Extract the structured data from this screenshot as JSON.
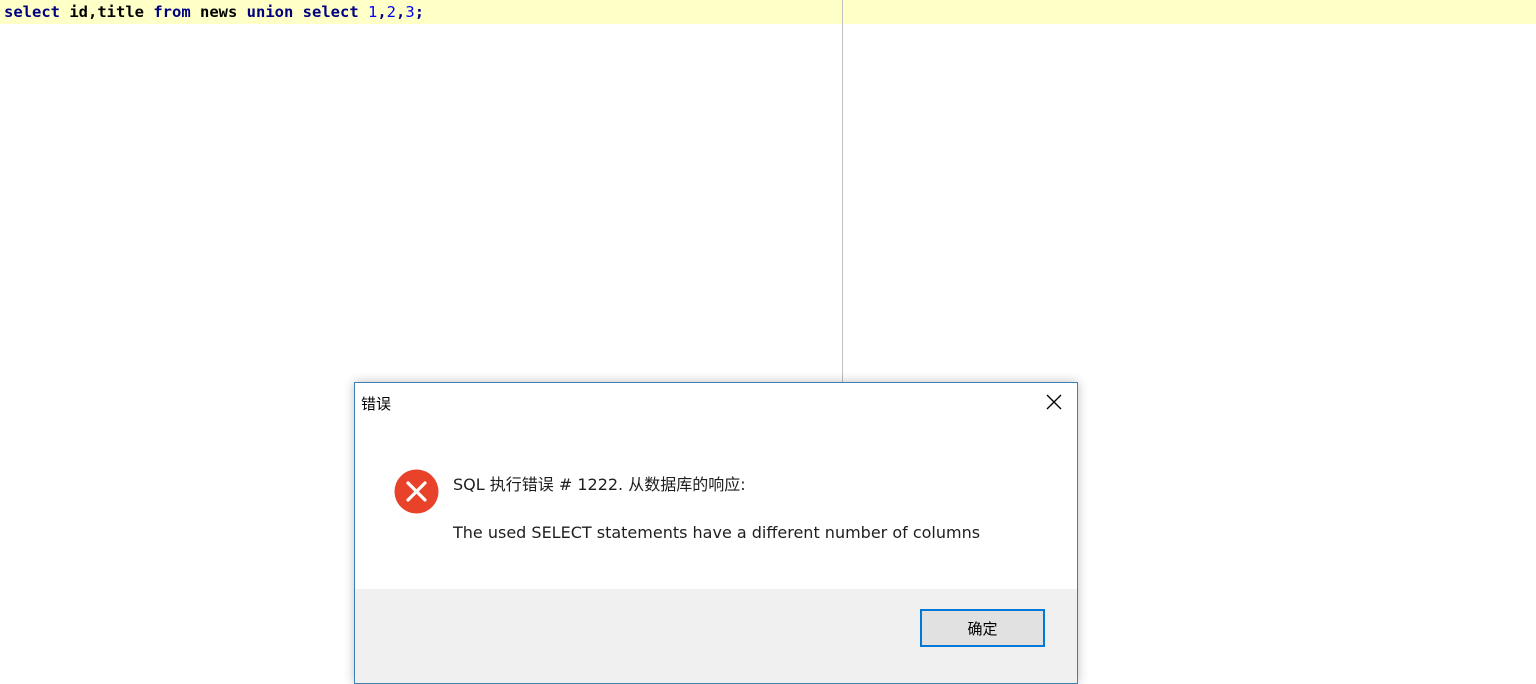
{
  "editor": {
    "tokens": {
      "kw_select": "select",
      "id_title": " id,title ",
      "kw_from": "from",
      "ident_news": " news ",
      "kw_union": "union",
      "kw_select2": " select ",
      "num1": "1",
      "comma1": ",",
      "num2": "2",
      "comma2": ",",
      "num3": "3",
      "semicolon": ";"
    }
  },
  "dialog": {
    "title": "错误",
    "message_line1": "SQL 执行错误 # 1222. 从数据库的响应:",
    "message_line2": "The used SELECT statements have a different number of columns",
    "ok_label": "确定",
    "icons": {
      "close": "close-icon",
      "error": "error-icon"
    },
    "colors": {
      "error_red": "#e8432a",
      "button_focus_border": "#0078d7",
      "footer_bg": "#f0f0f0"
    }
  }
}
